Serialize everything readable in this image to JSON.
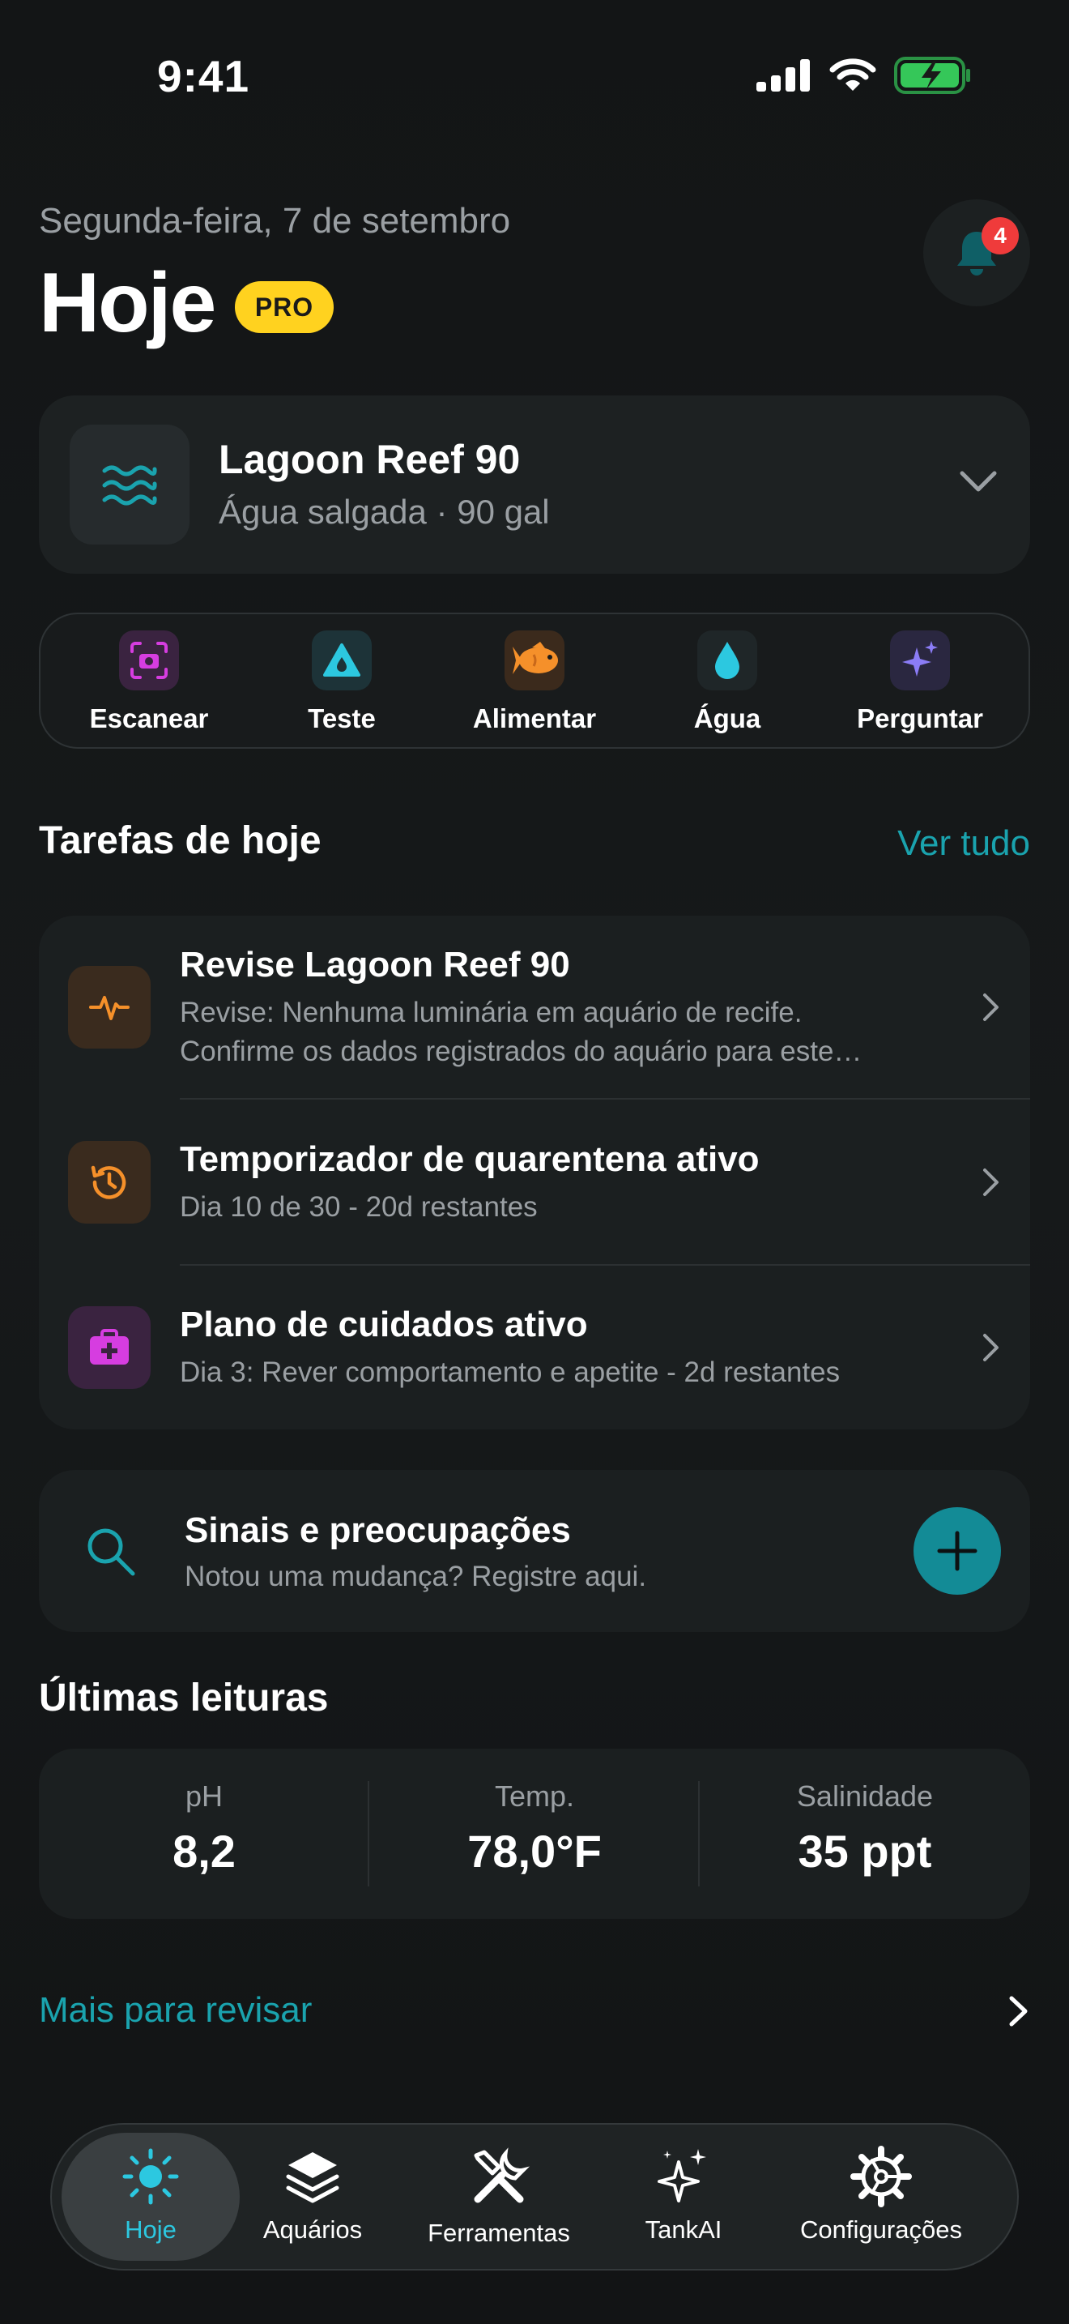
{
  "status_bar": {
    "time": "9:41"
  },
  "header": {
    "date": "Segunda-feira, 7 de setembro",
    "title": "Hoje",
    "badge": "PRO",
    "notification_count": "4"
  },
  "tank": {
    "name": "Lagoon Reef 90",
    "subtitle": "Água salgada · 90 gal"
  },
  "quick_actions": [
    {
      "label": "Escanear",
      "icon": "scan-camera-icon",
      "color": "#d63de0"
    },
    {
      "label": "Teste",
      "icon": "test-triangle-drop-icon",
      "color": "#2cc8e0"
    },
    {
      "label": "Alimentar",
      "icon": "fish-icon",
      "color": "#f5902a"
    },
    {
      "label": "Água",
      "icon": "water-drop-icon",
      "color": "#2cc8e0"
    },
    {
      "label": "Perguntar",
      "icon": "sparkles-icon",
      "color": "#8b7cf6"
    }
  ],
  "tasks": {
    "heading": "Tarefas de hoje",
    "see_all": "Ver tudo",
    "items": [
      {
        "title": "Revise Lagoon Reef 90",
        "desc1": "Revise: Nenhuma luminária em aquário de recife.",
        "desc2": "Confirme os dados registrados do aquário para este…",
        "icon": "pulse-icon"
      },
      {
        "title": "Temporizador de quarentena ativo",
        "desc1": "Dia 10 de 30 - 20d restantes",
        "icon": "history-clock-icon"
      },
      {
        "title": "Plano de cuidados ativo",
        "desc1": "Dia 3: Rever comportamento e apetite - 2d restantes",
        "icon": "medical-kit-icon"
      }
    ]
  },
  "signals": {
    "title": "Sinais e preocupações",
    "subtitle": "Notou uma mudança? Registre aqui."
  },
  "readings": {
    "heading": "Últimas leituras",
    "items": [
      {
        "label": "pH",
        "value": "8,2"
      },
      {
        "label": "Temp.",
        "value": "78,0°F"
      },
      {
        "label": "Salinidade",
        "value": "35 ppt"
      }
    ]
  },
  "more_link": "Mais para revisar",
  "tabbar": [
    {
      "label": "Hoje",
      "icon": "sun-icon",
      "active": true
    },
    {
      "label": "Aquários",
      "icon": "layers-icon"
    },
    {
      "label": "Ferramentas",
      "icon": "tools-icon"
    },
    {
      "label": "TankAI",
      "icon": "sparkles-icon"
    },
    {
      "label": "Configurações",
      "icon": "gear-icon"
    }
  ],
  "colors": {
    "accent": "#1aa3ae",
    "pro_badge": "#ffd21f",
    "notification_badge": "#ef3b3b",
    "battery": "#35c759"
  }
}
